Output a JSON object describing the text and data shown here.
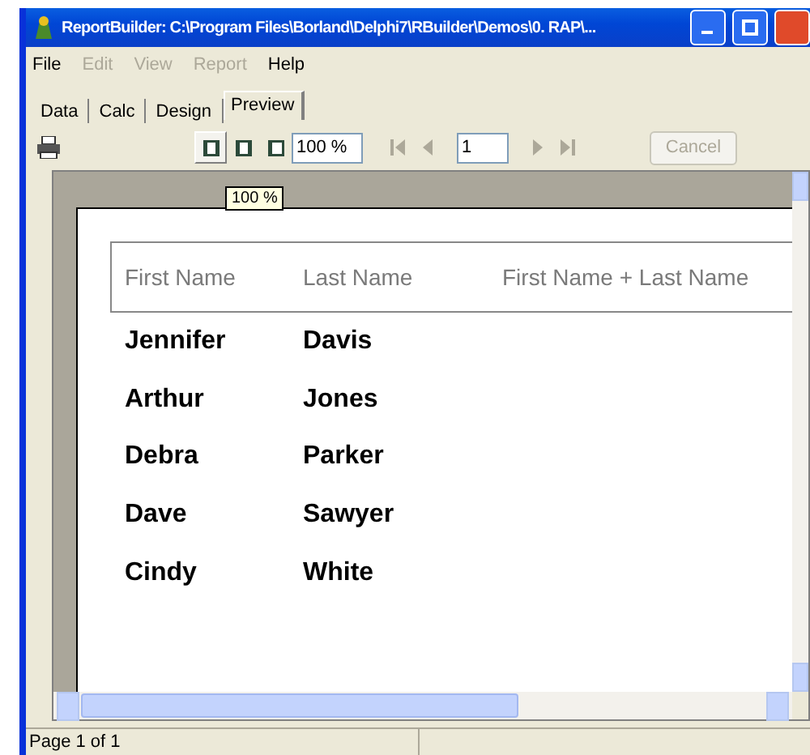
{
  "window": {
    "title": "ReportBuilder: C:\\Program Files\\Borland\\Delphi7\\RBuilder\\Demos\\0. RAP\\..."
  },
  "menu": [
    {
      "label": "File",
      "disabled": false
    },
    {
      "label": "Edit",
      "disabled": true
    },
    {
      "label": "View",
      "disabled": true
    },
    {
      "label": "Report",
      "disabled": true
    },
    {
      "label": "Help",
      "disabled": false
    }
  ],
  "tabs": [
    {
      "label": "Data",
      "selected": false
    },
    {
      "label": "Calc",
      "selected": false
    },
    {
      "label": "Design",
      "selected": false
    },
    {
      "label": "Preview",
      "selected": true
    }
  ],
  "toolbar": {
    "zoom": "100 %",
    "page": "1",
    "cancel": {
      "label": "Cancel",
      "disabled": true
    },
    "zoom_modes": [
      {
        "selected": true
      },
      {
        "selected": false
      },
      {
        "selected": false
      }
    ]
  },
  "tooltip": "100 %",
  "report": {
    "columns": [
      "First Name",
      "Last Name",
      "First Name + Last Name"
    ],
    "rows": [
      [
        "Jennifer",
        "Davis"
      ],
      [
        "Arthur",
        "Jones"
      ],
      [
        "Debra",
        "Parker"
      ],
      [
        "Dave",
        "Sawyer"
      ],
      [
        "Cindy",
        "White"
      ]
    ]
  },
  "status_bar": [
    "Page 1 of 1"
  ]
}
